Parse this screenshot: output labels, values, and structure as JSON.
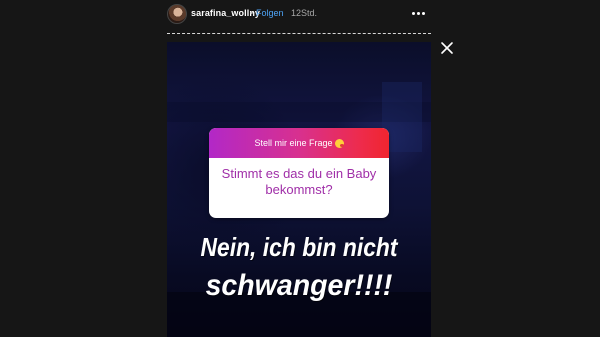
{
  "header": {
    "username": "sarafina_wollny",
    "separator": "•",
    "follow_label": "Folgen",
    "time_ago": "12Std."
  },
  "icons": {
    "more": "more-options-icon",
    "close": "close-icon",
    "emoji": "kissing-face-emoji-icon"
  },
  "question_sticker": {
    "prompt": "Stell mir eine Frage",
    "question": "Stimmt es das du ein Baby bekommst?"
  },
  "story_text": {
    "line1": "Nein, ich bin nicht",
    "line2": "schwanger!!!!"
  },
  "colors": {
    "background": "#161616",
    "follow_link": "#4da3f5",
    "question_text": "#a02fa8",
    "sticker_gradient_start": "#b228c7",
    "sticker_gradient_end": "#f0252f"
  }
}
